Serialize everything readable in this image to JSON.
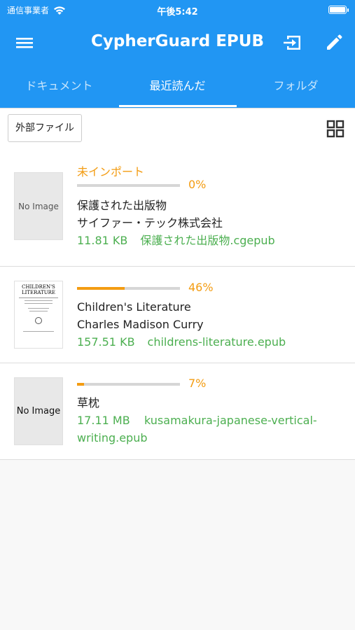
{
  "status_bar": {
    "carrier": "通信事業者",
    "time": "午後5:42"
  },
  "app_bar": {
    "title": "CypherGuard EPUB"
  },
  "tabs": [
    {
      "label": "ドキュメント"
    },
    {
      "label": "最近読んだ"
    },
    {
      "label": "フォルダ"
    }
  ],
  "active_tab": 1,
  "filter": {
    "external_files_label": "外部ファイル"
  },
  "documents": [
    {
      "thumbnail_text": "No Image",
      "status": "未インポート",
      "progress": 0,
      "progress_label": "0%",
      "title": "保護された出版物",
      "author": "サイファー・テック株式会社",
      "size": "11.81 KB",
      "filename": "保護された出版物.cgepub"
    },
    {
      "thumbnail_text": "CHILDREN'S LITERATURE",
      "status": "",
      "progress": 0.46,
      "progress_label": "46%",
      "title": "Children's Literature",
      "author": "Charles Madison Curry",
      "size": "157.51 KB",
      "filename": "childrens-literature.epub"
    },
    {
      "thumbnail_text": "No Image",
      "status": "",
      "progress": 0.07,
      "progress_label": "7%",
      "title": "草枕",
      "author": "",
      "size": "17.11 MB",
      "filename": "kusamakura-japanese-vertical-writing.epub"
    }
  ],
  "colors": {
    "primary": "#2196f3",
    "progress": "#f39c12",
    "meta": "#4caf50"
  },
  "icons": {
    "menu": "menu-icon",
    "import": "import-icon",
    "edit": "pencil-icon",
    "grid": "grid-view-icon",
    "wifi": "wifi-icon",
    "battery": "battery-icon"
  }
}
